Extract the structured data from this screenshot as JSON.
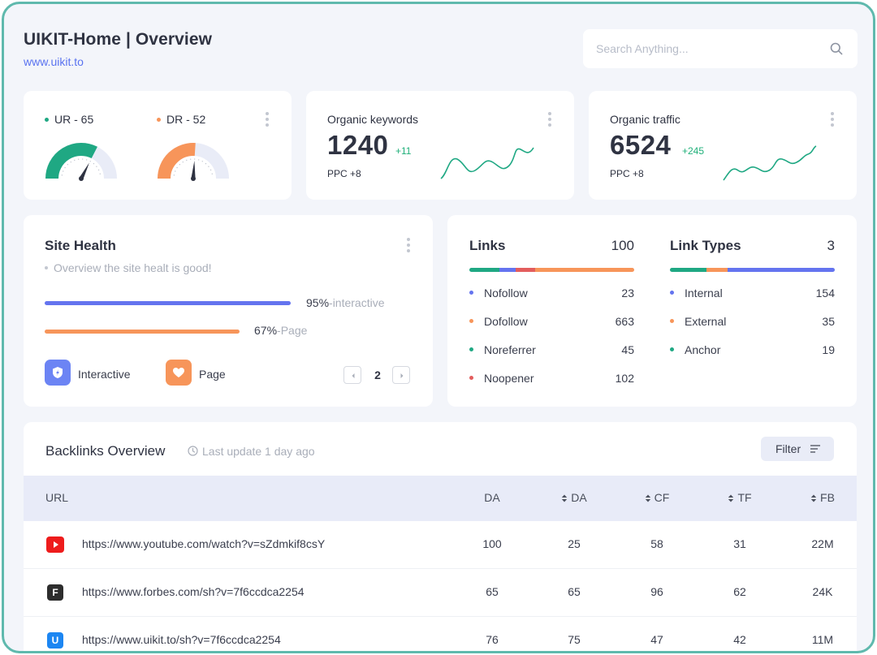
{
  "header": {
    "title": "UIKIT-Home | Overview",
    "url": "www.uikit.to"
  },
  "search": {
    "placeholder": "Search Anything..."
  },
  "gauges": [
    {
      "label": "UR - 65",
      "value": 65,
      "color": "#1fa883",
      "dot_color": "#1fa883"
    },
    {
      "label": "DR - 52",
      "value": 52,
      "color": "#f7955a",
      "dot_color": "#f7955a"
    }
  ],
  "organic_keywords": {
    "title": "Organic keywords",
    "value": "1240",
    "delta": "+11",
    "ppc": "PPC +8"
  },
  "organic_traffic": {
    "title": "Organic traffic",
    "value": "6524",
    "delta": "+245",
    "ppc": "PPC +8"
  },
  "site_health": {
    "title": "Site Health",
    "subtitle": "Overview the site healt is good!",
    "bars": [
      {
        "percent": "95%",
        "label": "-interactive",
        "value": 95,
        "color": "#6474ef"
      },
      {
        "percent": "67%",
        "label": "-Page",
        "value": 67,
        "color": "#f7955a"
      }
    ],
    "legend": [
      {
        "label": "Interactive",
        "color": "#6c84f4"
      },
      {
        "label": "Page",
        "color": "#f7955a"
      }
    ],
    "page": "2"
  },
  "links": {
    "title": "Links",
    "total": "100",
    "segments": [
      {
        "color": "#1fa883",
        "value": 18
      },
      {
        "color": "#6474ef",
        "value": 10
      },
      {
        "color": "#e35d5d",
        "value": 12
      },
      {
        "color": "#f7955a",
        "value": 60
      }
    ],
    "items": [
      {
        "label": "Nofollow",
        "value": "23",
        "color": "#6474ef"
      },
      {
        "label": "Dofollow",
        "value": "663",
        "color": "#f7955a"
      },
      {
        "label": "Noreferrer",
        "value": "45",
        "color": "#1fa883"
      },
      {
        "label": "Noopener",
        "value": "102",
        "color": "#e35d5d"
      }
    ]
  },
  "link_types": {
    "title": "Link Types",
    "total": "3",
    "segments": [
      {
        "color": "#1fa883",
        "value": 22
      },
      {
        "color": "#f7955a",
        "value": 13
      },
      {
        "color": "#6474ef",
        "value": 65
      }
    ],
    "items": [
      {
        "label": "Internal",
        "value": "154",
        "color": "#6474ef"
      },
      {
        "label": "External",
        "value": "35",
        "color": "#f7955a"
      },
      {
        "label": "Anchor",
        "value": "19",
        "color": "#1fa883"
      }
    ]
  },
  "backlinks": {
    "title": "Backlinks Overview",
    "last_update": "Last update 1 day ago",
    "filter_label": "Filter",
    "columns": [
      "URL",
      "DA",
      "DA",
      "CF",
      "TF",
      "FB"
    ],
    "rows": [
      {
        "icon": "youtube-icon",
        "icon_color": "#ee1c1c",
        "icon_letter": "",
        "url": "https://www.youtube.com/watch?v=sZdmkif8csY",
        "da": "100",
        "da2": "25",
        "cf": "58",
        "tf": "31",
        "fb": "22M"
      },
      {
        "icon": "forbes-icon",
        "icon_color": "#2d2d2d",
        "icon_letter": "F",
        "url": "https://www.forbes.com/sh?v=7f6ccdca2254",
        "da": "65",
        "da2": "65",
        "cf": "96",
        "tf": "62",
        "fb": "24K"
      },
      {
        "icon": "uikit-icon",
        "icon_color": "#1c86f2",
        "icon_letter": "U",
        "url": "https://www.uikit.to/sh?v=7f6ccdca2254",
        "da": "76",
        "da2": "75",
        "cf": "47",
        "tf": "42",
        "fb": "11M"
      }
    ]
  }
}
